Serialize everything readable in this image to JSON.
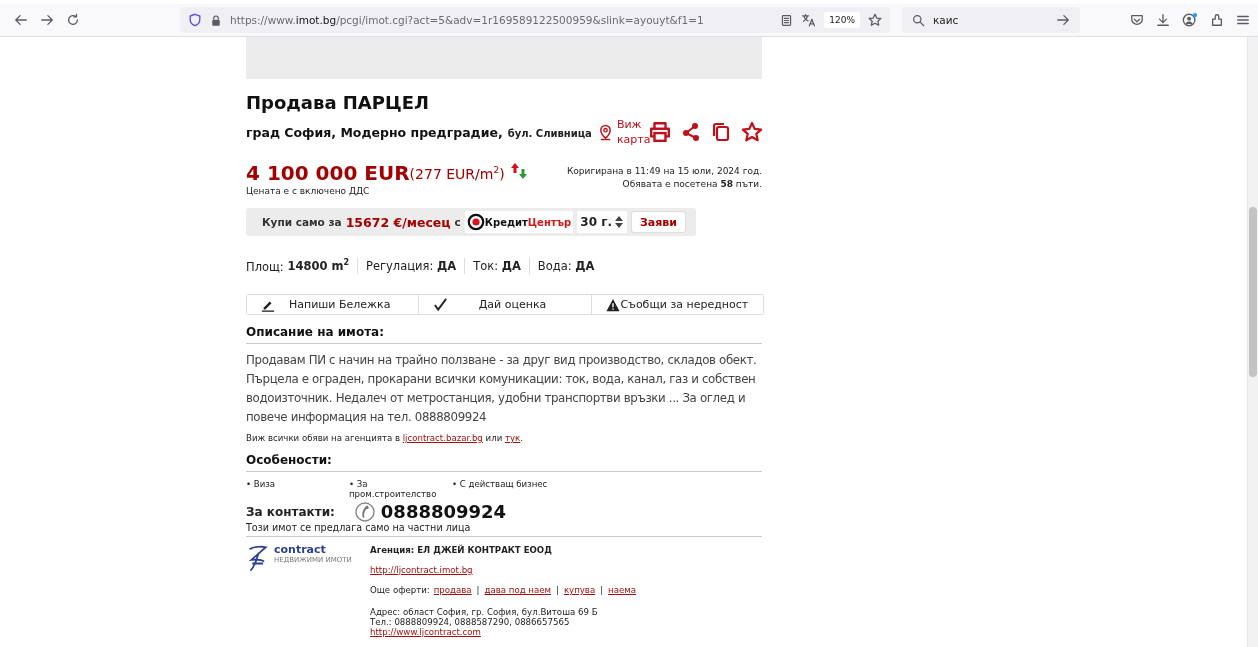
{
  "browser": {
    "url": "https://www.**imot.bg**/pcgi/imot.cgi?act=5&adv=1r169589122500959&slink=ayouyt&f1=1",
    "zoom": "120%",
    "search_value": "каис"
  },
  "listing": {
    "title": "Продава ПАРЦЕЛ",
    "location": "град София, Модерно предградие,",
    "street": "бул. Сливница",
    "map_link": "Виж карта",
    "price": "4 100 000 EUR",
    "price_per_m2": "(277 EUR/m$^{2}$)",
    "vat_note": "Цената е с включено ДДС",
    "updated": "Коригирана в 11:49 на 15 юли, 2024 год.",
    "views": "Обявата е посетена **58** пъти."
  },
  "credit": {
    "lead": "Купи само за",
    "amount": "15672 €/месец",
    "conj": "с",
    "logo_first": "Кредит",
    "logo_second": "Център",
    "term": "30 г.",
    "button": "Заяви"
  },
  "params": [
    {
      "label": "Площ:",
      "value": "14800 m$^{2}$"
    },
    {
      "label": "Регулация:",
      "value": "ДА"
    },
    {
      "label": "Ток:",
      "value": "ДА"
    },
    {
      "label": "Вода:",
      "value": "ДА"
    }
  ],
  "actions": [
    {
      "kind": "note",
      "label": "Напиши Бележка"
    },
    {
      "kind": "rate",
      "label": "Дай оценка"
    },
    {
      "kind": "report",
      "label": "Съобщи за нередност"
    }
  ],
  "description": {
    "heading": "Описание на имота:",
    "text": "Продавам ПИ с начин на трайно ползване - за друг вид производство, складов обект. Пърцела е ограден, прокарани всички комуникации: ток, вода, канал, газ и собствен водоизточник. Недалеч от метростанция, удобни транспортви връзки ... За оглед и повече информация на тел. 0888809924",
    "agency_lead": "Виж всички обяви на агенцията в",
    "agency_link": "ljcontract.bazar.bg",
    "agency_or": "или",
    "agency_here": "тук",
    "agency_end": "."
  },
  "features": {
    "heading": "Особености:",
    "items": [
      "• Виза",
      "• За пром.строителство",
      "• С действащ бизнес"
    ]
  },
  "contacts": {
    "label": "За контакти:",
    "phone": "0888809924",
    "note": "Този имот се предлага само на частни лица"
  },
  "agency": {
    "logo_word": "contract",
    "logo_sub": "НЕДВИЖИМИ ИМОТИ",
    "name": "Агенция: ЕЛ ДЖЕЙ КОНТРАКТ ЕООД",
    "site": "http://ljcontract.imot.bg",
    "offers_label": "Още оферти:",
    "offers_separator": "|",
    "offers": [
      "продава",
      "дава под наем",
      "купува",
      "наема"
    ],
    "address": "Адрес: област София, гр. София, бул.Витоша 69 Б",
    "phones": "Тел.: 0888809924, 0888587290, 0886657565",
    "website": "http://www.ljcontract.com"
  }
}
